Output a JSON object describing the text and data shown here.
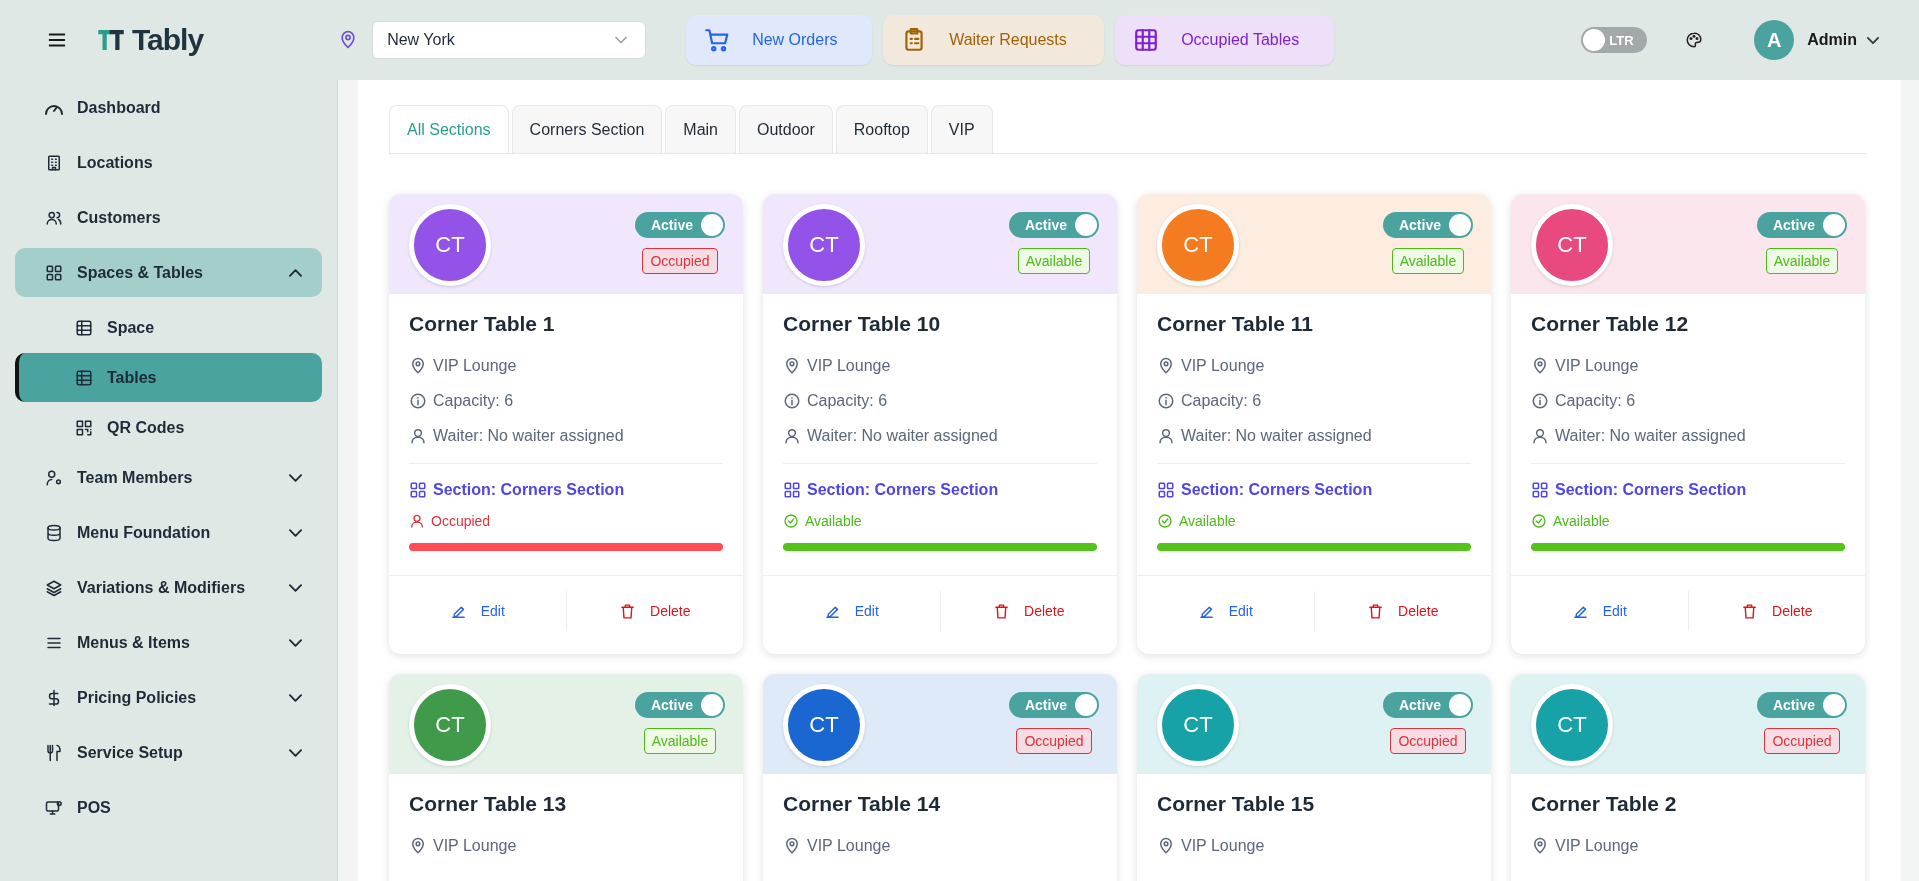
{
  "header": {
    "brand": "Tably",
    "location": {
      "value": "New York"
    },
    "quick_actions": [
      {
        "label": "New Orders",
        "color": "#2563eb"
      },
      {
        "label": "Waiter Requests",
        "color": "#a16207"
      },
      {
        "label": "Occupied Tables",
        "color": "#7e22ce"
      }
    ],
    "direction_toggle": {
      "label": "LTR",
      "on": false
    },
    "user": {
      "initial": "A",
      "name": "Admin"
    }
  },
  "sidebar": {
    "items": [
      {
        "label": "Dashboard",
        "selected": false
      },
      {
        "label": "Locations",
        "selected": false
      },
      {
        "label": "Customers",
        "selected": false
      },
      {
        "label": "Spaces & Tables",
        "selected": true,
        "expanded": true,
        "children": [
          {
            "label": "Space",
            "selected": false
          },
          {
            "label": "Tables",
            "selected": true
          },
          {
            "label": "QR Codes",
            "selected": false
          }
        ]
      },
      {
        "label": "Team Members",
        "selected": false,
        "expanded": false
      },
      {
        "label": "Menu Foundation",
        "selected": false,
        "expanded": false
      },
      {
        "label": "Variations & Modifiers",
        "selected": false,
        "expanded": false
      },
      {
        "label": "Menus & Items",
        "selected": false,
        "expanded": false
      },
      {
        "label": "Pricing Policies",
        "selected": false,
        "expanded": false
      },
      {
        "label": "Service Setup",
        "selected": false,
        "expanded": false
      },
      {
        "label": "POS",
        "selected": false
      }
    ]
  },
  "tabs": [
    {
      "label": "All Sections",
      "selected": true
    },
    {
      "label": "Corners Section",
      "selected": false
    },
    {
      "label": "Main",
      "selected": false
    },
    {
      "label": "Outdoor",
      "selected": false
    },
    {
      "label": "Rooftop",
      "selected": false
    },
    {
      "label": "VIP",
      "selected": false
    }
  ],
  "tables": [
    {
      "initials": "CT",
      "color": "#9353e8",
      "active_label": "Active",
      "active": true,
      "occupied": true,
      "badge": "Occupied",
      "name": "Corner Table 1",
      "location": "VIP Lounge",
      "capacity": "Capacity: 6",
      "waiter": "Waiter: No waiter assigned",
      "section": "Section: Corners Section",
      "status_text": "Occupied",
      "edit": "Edit",
      "delete": "Delete"
    },
    {
      "initials": "CT",
      "color": "#9353e8",
      "active_label": "Active",
      "active": true,
      "occupied": false,
      "badge": "Available",
      "name": "Corner Table 10",
      "location": "VIP Lounge",
      "capacity": "Capacity: 6",
      "waiter": "Waiter: No waiter assigned",
      "section": "Section: Corners Section",
      "status_text": "Available",
      "edit": "Edit",
      "delete": "Delete"
    },
    {
      "initials": "CT",
      "color": "#f47b20",
      "active_label": "Active",
      "active": true,
      "occupied": false,
      "badge": "Available",
      "name": "Corner Table 11",
      "location": "VIP Lounge",
      "capacity": "Capacity: 6",
      "waiter": "Waiter: No waiter assigned",
      "section": "Section: Corners Section",
      "status_text": "Available",
      "edit": "Edit",
      "delete": "Delete"
    },
    {
      "initials": "CT",
      "color": "#e84a7f",
      "active_label": "Active",
      "active": true,
      "occupied": false,
      "badge": "Available",
      "name": "Corner Table 12",
      "location": "VIP Lounge",
      "capacity": "Capacity: 6",
      "waiter": "Waiter: No waiter assigned",
      "section": "Section: Corners Section",
      "status_text": "Available",
      "edit": "Edit",
      "delete": "Delete"
    },
    {
      "initials": "CT",
      "color": "#3f9a4a",
      "active_label": "Active",
      "active": true,
      "occupied": false,
      "badge": "Available",
      "name": "Corner Table 13",
      "location": "VIP Lounge"
    },
    {
      "initials": "CT",
      "color": "#1a67d2",
      "active_label": "Active",
      "active": true,
      "occupied": true,
      "badge": "Occupied",
      "name": "Corner Table 14",
      "location": "VIP Lounge"
    },
    {
      "initials": "CT",
      "color": "#17a2a8",
      "active_label": "Active",
      "active": true,
      "occupied": true,
      "badge": "Occupied",
      "name": "Corner Table 15",
      "location": "VIP Lounge"
    },
    {
      "initials": "CT",
      "color": "#17a2a8",
      "active_label": "Active",
      "active": true,
      "occupied": true,
      "badge": "Occupied",
      "name": "Corner Table 2",
      "location": "VIP Lounge"
    }
  ]
}
